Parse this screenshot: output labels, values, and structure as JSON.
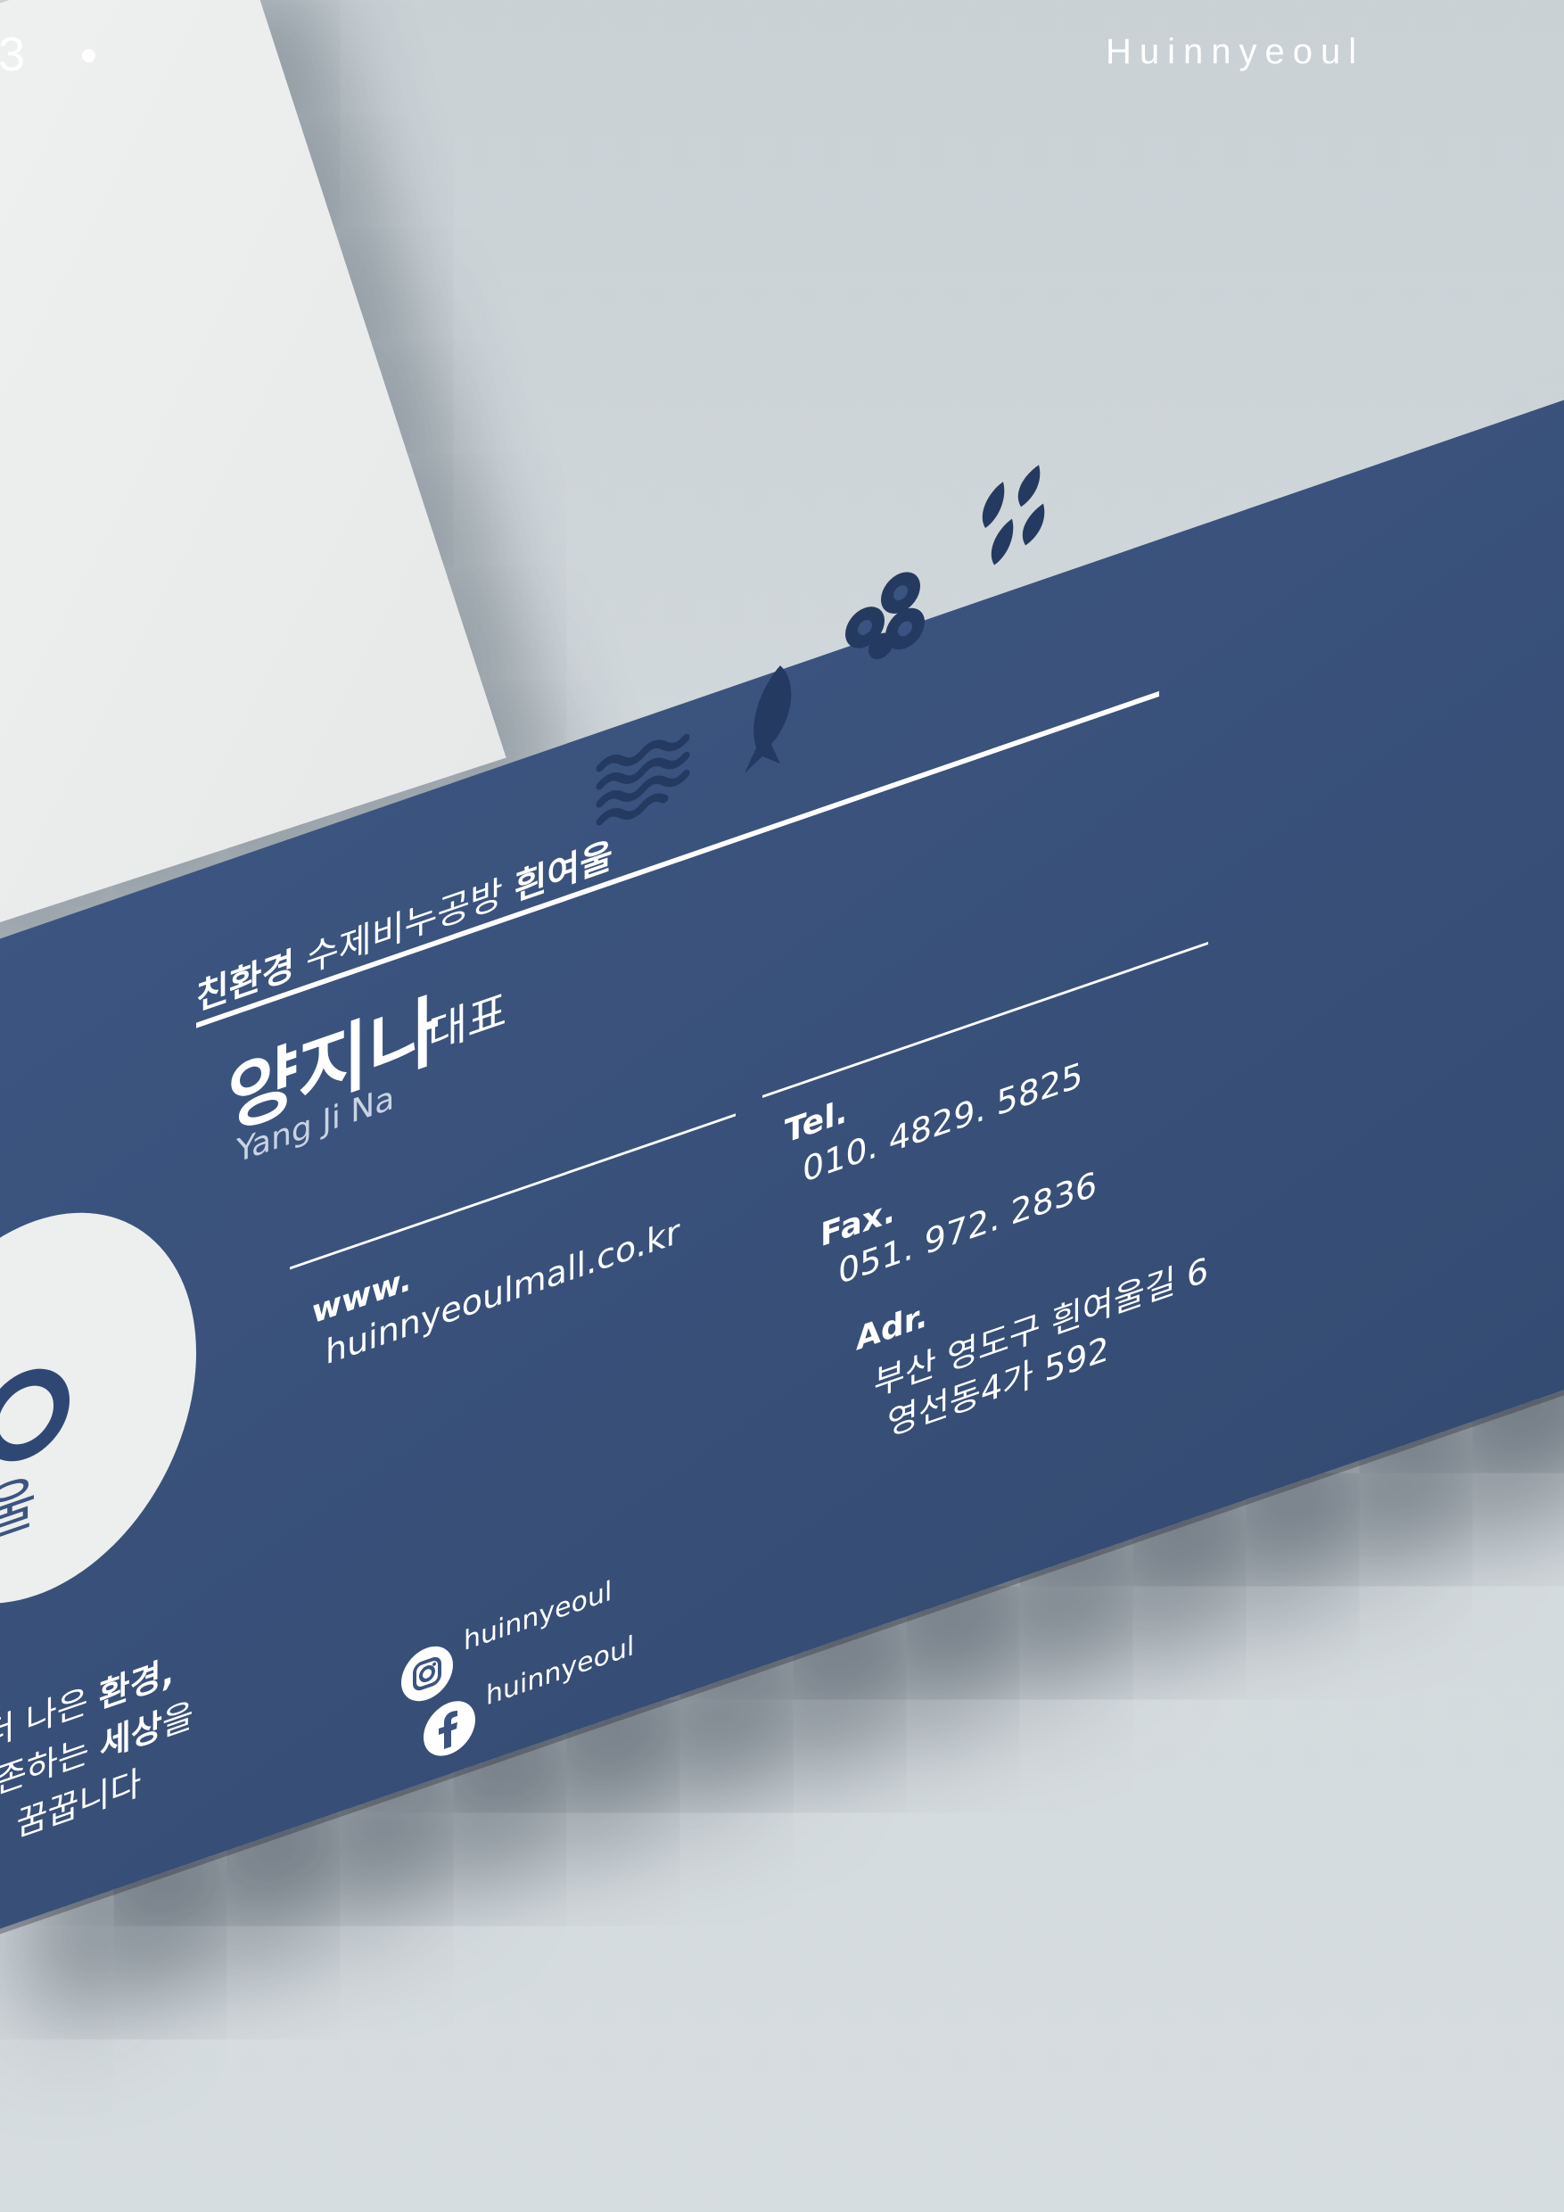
{
  "header": {
    "page_number": "3",
    "brand": "Huinnyeoul"
  },
  "card": {
    "logo_text": "여울",
    "company_prefix": "친환경",
    "company_middle": "수제비누공방",
    "company_name": "흰여울",
    "name": "양지나",
    "title": "대표",
    "name_en": "Yang Ji Na",
    "www_label": "www.",
    "www_value": "huinnyeoulmall.co.kr",
    "tel_label": "Tel.",
    "tel_value": "010. 4829. 5825",
    "fax_label": "Fax.",
    "fax_value": "051. 972. 2836",
    "adr_label": "Adr.",
    "adr_line1": "부산 영도구 흰여울길 6",
    "adr_line2": "영선동4가 592",
    "tagline_1a": "더 나은 ",
    "tagline_1b": "환경,",
    "tagline_2a": "공존하는 ",
    "tagline_2b": "세상",
    "tagline_2c": "을",
    "tagline_3": "꿈꿉니다",
    "instagram_handle": "huinnyeoul",
    "facebook_handle": "huinnyeoul",
    "colors": {
      "card_blue": "#3a5380",
      "logo_green": "#5fb08a",
      "logo_navy": "#2f4873",
      "pictogram_navy": "#243a60"
    },
    "pictograms": [
      "waves-icon",
      "fish-icon",
      "bubbles-icon",
      "leaves-icon"
    ]
  }
}
